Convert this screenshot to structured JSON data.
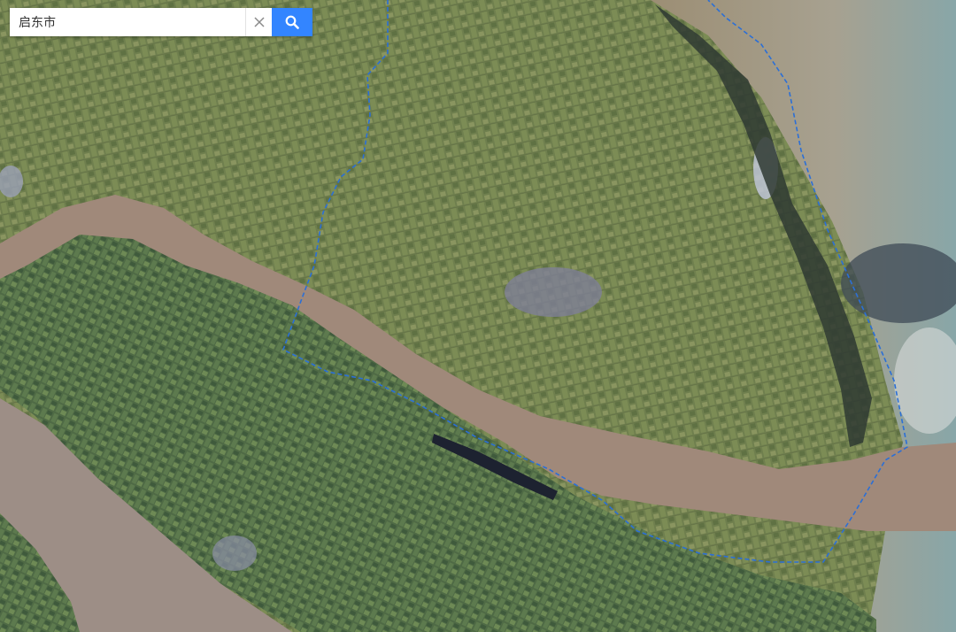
{
  "search": {
    "value": "启东市",
    "placeholder": "",
    "clear_icon": "close-icon",
    "button_icon": "search-icon",
    "button_color": "#3385ff"
  },
  "map": {
    "view": "satellite",
    "boundary_color": "#2b6fd6"
  }
}
